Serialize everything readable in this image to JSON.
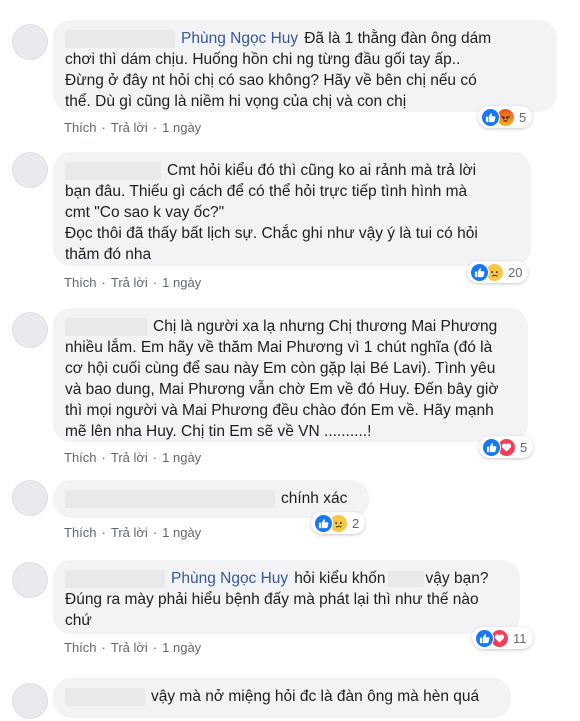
{
  "comments": [
    {
      "author": "Phùng Ngọc Huy",
      "lines": [
        "Đã là 1 thằng đàn ông dám",
        "chơi thì dám chịu. Huống hồn chi ng từng đầu gối tay ấp..",
        "Đừng ở đây nt hỏi chị có sao không? Hãy về bên chị nếu có",
        "thể. Dù gì cũng là niềm hi vọng của chị và con chị"
      ],
      "like_label": "Thích",
      "reply_label": "Trả lời",
      "time": "1 ngày",
      "reactions": [
        "like-icon",
        "angry-icon"
      ],
      "reaction_count": "5"
    },
    {
      "lines": [
        "Cmt hỏi kiểu đó thì cũng ko ai rảnh mà trả lời",
        "bạn đâu. Thiếu gì cách để có thể hỏi trực tiếp tình hình mà",
        "cmt \"Co sao k vay ốc?\"",
        "Đọc thôi đã thấy bất lịch sự. Chắc ghi như vậy ý là tui có hỏi",
        "thăm đó nha"
      ],
      "like_label": "Thích",
      "reply_label": "Trả lời",
      "time": "1 ngày",
      "reactions": [
        "like-icon",
        "sad-icon"
      ],
      "reaction_count": "20"
    },
    {
      "lines": [
        "Chị là người xa lạ nhưng Chị thương Mai Phương",
        "nhiều lắm. Em hãy về thăm Mai Phương vì 1 chút nghĩa (đó là",
        "cơ hội cuối cùng để sau này Em còn gặp lại Bé Lavi). Tình yêu",
        "và bao dung, Mai Phương vẫn chờ Em về đó Huy. Đến bây giờ",
        "thì mọi người và Mai Phương đều chào đón Em về. Hãy mạnh",
        "mẽ lên nha Huy. Chị tin Em sẽ về VN ..........!"
      ],
      "like_label": "Thích",
      "reply_label": "Trả lời",
      "time": "1 ngày",
      "reactions": [
        "like-icon",
        "love-icon"
      ],
      "reaction_count": "5"
    },
    {
      "lines": [
        "chính xác"
      ],
      "like_label": "Thích",
      "reply_label": "Trả lời",
      "time": "1 ngày",
      "reactions": [
        "like-icon",
        "sad-icon"
      ],
      "reaction_count": "2"
    },
    {
      "author": "Phùng Ngọc Huy",
      "lines_pre": "hỏi kiểu khốn",
      "lines_post": "vậy bạn?",
      "lines": [
        "Đúng ra mày phải hiểu bệnh đấy mà phát lại thì như thế nào",
        "chứ"
      ],
      "like_label": "Thích",
      "reply_label": "Trả lời",
      "time": "1 ngày",
      "reactions": [
        "like-icon",
        "love-icon"
      ],
      "reaction_count": "11"
    },
    {
      "lines": [
        "vậy mà nở miệng hỏi đc là đàn ông mà hèn quá"
      ]
    }
  ],
  "colors": {
    "bubble": "#f2f3f5",
    "link": "#385898",
    "meta": "#606770",
    "like": "#1877f2",
    "love": "#f33e58",
    "sad": "#f7c746"
  }
}
